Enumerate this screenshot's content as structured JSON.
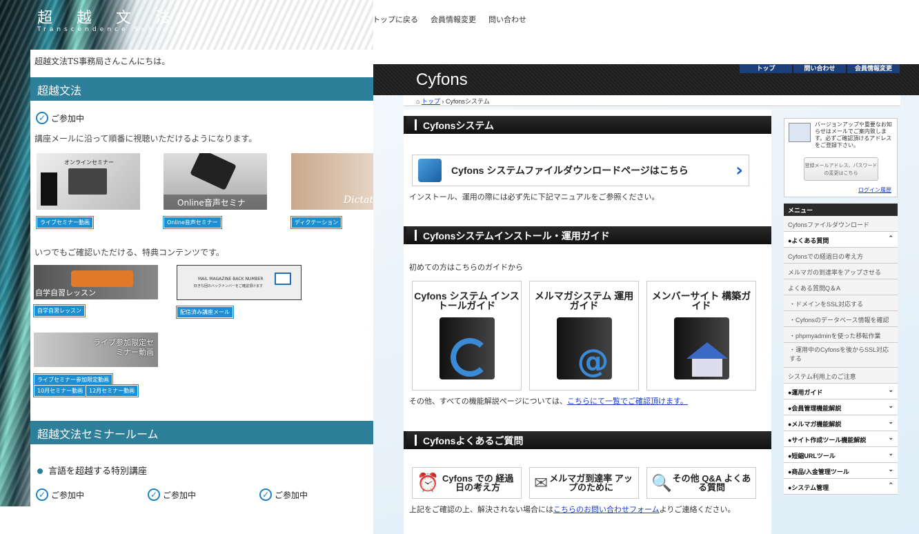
{
  "left": {
    "brand_jp": "超 越 文 法",
    "brand_en": "Transcendence School",
    "greeting": "超越文法TS事務局さんこんにちは。",
    "section1": "超越文法",
    "participating": "ご参加中",
    "desc1": "講座メールに沿って順番に視聴いただけるようになります。",
    "thumbs": [
      {
        "caption": "オンラインセミナー",
        "tag": "ライブセミナー動画"
      },
      {
        "caption": "Online音声セミナー",
        "tag": "Online音声セミナー"
      },
      {
        "caption": "Dictat",
        "tag": "ディクテーション"
      }
    ],
    "desc2": "いつでもご確認いただける、特典コンテンツです。",
    "bonus": [
      {
        "caption": "自学自習レッスン",
        "tag": "自学自習レッスン"
      },
      {
        "caption": "MAIL MAGAZINE BACK NUMBER",
        "sub": "好きな回のバックナンバーをご確認頂けます",
        "tag": "配信済み講座メール"
      }
    ],
    "live": {
      "caption": "ライブ参加限定セミナー動画",
      "tags": [
        "ライブセミナー参加限定動画",
        "10月セミナー動画",
        "12月セミナー動画"
      ]
    },
    "section2": "超越文法セミナールーム",
    "course": "言語を超越する特別講座",
    "checks": [
      "ご参加中",
      "ご参加中",
      "ご参加中"
    ]
  },
  "topnav": [
    "トップに戻る",
    "会員情報変更",
    "問い合わせ"
  ],
  "cyfons": {
    "logo": "Cyfons",
    "tabs": [
      "トップ",
      "問い合わせ",
      "会員情報変更"
    ],
    "breadcrumb_home": "トップ",
    "breadcrumb_current": "Cyfonsシステム",
    "h1": "Cyfonsシステム",
    "download": "Cyfons システムファイルダウンロードページはこちら",
    "install_note": "インストール、運用の際には必ず先に下記マニュアルをご参照ください。",
    "h2": "Cyfonsシステムインストール・運用ガイド",
    "first_time": "初めての方はこちらのガイドから",
    "guides": [
      "Cyfons システム インストールガイド",
      "メルマガシステム 運用ガイド",
      "メンバーサイト 構築ガイド"
    ],
    "other_pre": "その他、すべての機能解説ページについては、",
    "other_link": "こちらにて一覧でご確認頂けます。",
    "h3": "Cyfonsよくあるご質問",
    "faqs": [
      "Cyfons での 経過日の考え方",
      "メルマガ到達率 アップのために",
      "その他 Q&A よくある質問"
    ],
    "contact_pre": "上記をご確認の上、解決されない場合には",
    "contact_link": "こちらのお問い合わせフォーム",
    "contact_post": "よりご連絡ください。",
    "side_msg": "バージョンアップや重要なお知らせはメールでご案内致します。必ずご確認頂けるアドレスをご登録下さい。",
    "side_btn": "登録メールアドレス、パスワードの変更はこちら",
    "login": "ログイン履歴",
    "menu_title": "メニュー",
    "menu": [
      {
        "label": "Cyfonsファイルダウンロード",
        "type": "item"
      },
      {
        "label": "●よくある質問",
        "type": "head",
        "chev": "^"
      },
      {
        "label": "Cyfonsでの経過日の考え方",
        "type": "item"
      },
      {
        "label": "メルマガの到達率をアップさせる",
        "type": "item"
      },
      {
        "label": "よくある質問Q＆A",
        "type": "item"
      },
      {
        "label": "・ドメインをSSL対応する",
        "type": "sub"
      },
      {
        "label": "・Cyfonsのデータベース情報を確認",
        "type": "sub"
      },
      {
        "label": "・phpmyadminを使った移転作業",
        "type": "sub"
      },
      {
        "label": "・運用中のCyfonsを後からSSL対応する",
        "type": "sub2"
      },
      {
        "label": "システム利用上のご注意",
        "type": "item"
      },
      {
        "label": "●運用ガイド",
        "type": "head",
        "chev": "v"
      },
      {
        "label": "●会員管理機能解説",
        "type": "head",
        "chev": "v"
      },
      {
        "label": "●メルマガ機能解説",
        "type": "head",
        "chev": "v"
      },
      {
        "label": "●サイト作成ツール機能解説",
        "type": "head",
        "chev": "v"
      },
      {
        "label": "●短縮URLツール",
        "type": "head",
        "chev": "v"
      },
      {
        "label": "●商品/入金管理ツール",
        "type": "head",
        "chev": "v"
      },
      {
        "label": "●システム管理",
        "type": "head",
        "chev": "^"
      }
    ]
  }
}
